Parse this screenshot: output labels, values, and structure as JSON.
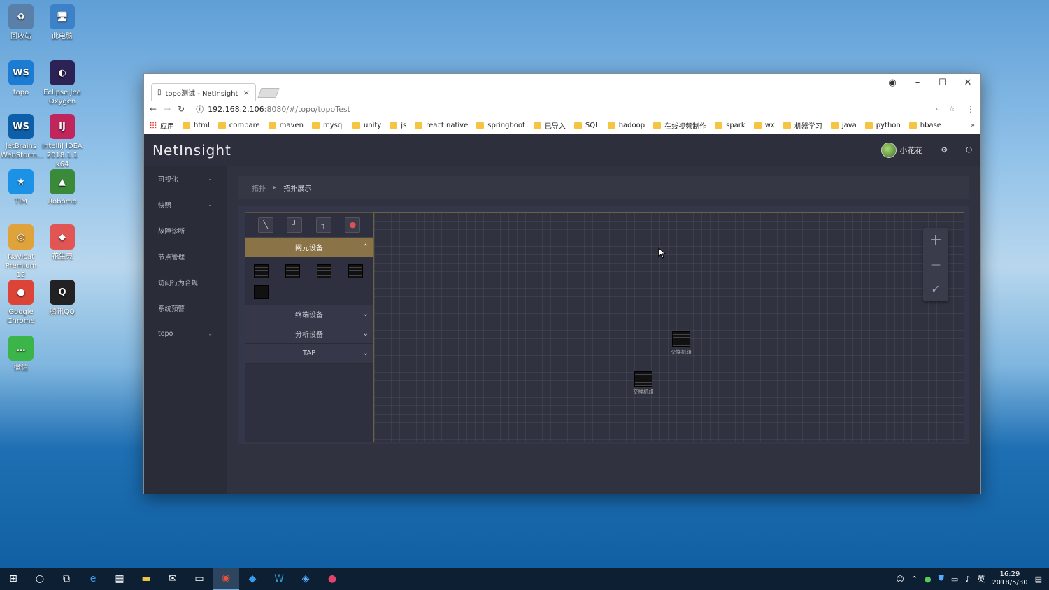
{
  "desktop": {
    "icons": [
      {
        "label": "回收站",
        "glyph": "♻",
        "bg": "#5a7fa8"
      },
      {
        "label": "此电脑",
        "glyph": "🖥",
        "bg": "#3d82c9"
      },
      {
        "label": "topo",
        "glyph": "WS",
        "bg": "#1c7bd2"
      },
      {
        "label": "Eclipse Jee Oxygen",
        "glyph": "◐",
        "bg": "#2c2255"
      },
      {
        "label": "JetBrains WebStorm...",
        "glyph": "WS",
        "bg": "#0c5fa8"
      },
      {
        "label": "IntelliJ IDEA 2018.1.1 x64",
        "glyph": "IJ",
        "bg": "#c0265b"
      },
      {
        "label": "TIM",
        "glyph": "★",
        "bg": "#1b92e6"
      },
      {
        "label": "Robomo",
        "glyph": "▲",
        "bg": "#3a8a3a"
      },
      {
        "label": "Navicat Premium 12",
        "glyph": "◎",
        "bg": "#e0a23a"
      },
      {
        "label": "花生壳",
        "glyph": "◆",
        "bg": "#e25555"
      },
      {
        "label": "Google Chrome",
        "glyph": "●",
        "bg": "#db4437"
      },
      {
        "label": "腾讯QQ",
        "glyph": "Q",
        "bg": "#222"
      },
      {
        "label": "微信",
        "glyph": "…",
        "bg": "#3bb44a"
      }
    ]
  },
  "browser": {
    "tab_title": "topo测试 - NetInsight",
    "tab_close": "×",
    "url_host": "192.168.2.106",
    "url_rest": ":8080/#/topo/topoTest",
    "window_controls": [
      "–",
      "☐",
      "✕"
    ],
    "bookmarks": [
      "应用",
      "html",
      "compare",
      "maven",
      "mysql",
      "unity",
      "js",
      "react native",
      "springboot",
      "已导入",
      "SQL",
      "hadoop",
      "在线视频制作",
      "spark",
      "wx",
      "机器学习",
      "java",
      "python",
      "hbase"
    ],
    "bookmarks_more": "»"
  },
  "app": {
    "logo": "NetInsight",
    "user_name": "小花花",
    "sidebar": [
      {
        "label": "可视化",
        "chevron": "⌄"
      },
      {
        "label": "快照",
        "chevron": "⌄"
      },
      {
        "label": "故障诊断",
        "chevron": ""
      },
      {
        "label": "节点管理",
        "chevron": ""
      },
      {
        "label": "访问行为合规",
        "chevron": ""
      },
      {
        "label": "系统预警",
        "chevron": ""
      },
      {
        "label": "topo",
        "chevron": "⌄"
      }
    ],
    "breadcrumb": {
      "parent": "拓扑",
      "separator": "▶",
      "current": "拓扑展示"
    },
    "palette": {
      "groups": [
        {
          "label": "网元设备",
          "arrow": "⌃",
          "active": true
        },
        {
          "label": "终端设备",
          "arrow": "⌄",
          "active": false
        },
        {
          "label": "分析设备",
          "arrow": "⌄",
          "active": false
        },
        {
          "label": "TAP",
          "arrow": "⌄",
          "active": false
        }
      ]
    },
    "canvas": {
      "nodes": [
        {
          "label": "交换机组"
        },
        {
          "label": "交换机组"
        }
      ],
      "zoom_controls": [
        "+",
        "—",
        "✓"
      ]
    }
  },
  "taskbar": {
    "time": "16:29",
    "date": "2018/5/30",
    "ime": "英"
  }
}
